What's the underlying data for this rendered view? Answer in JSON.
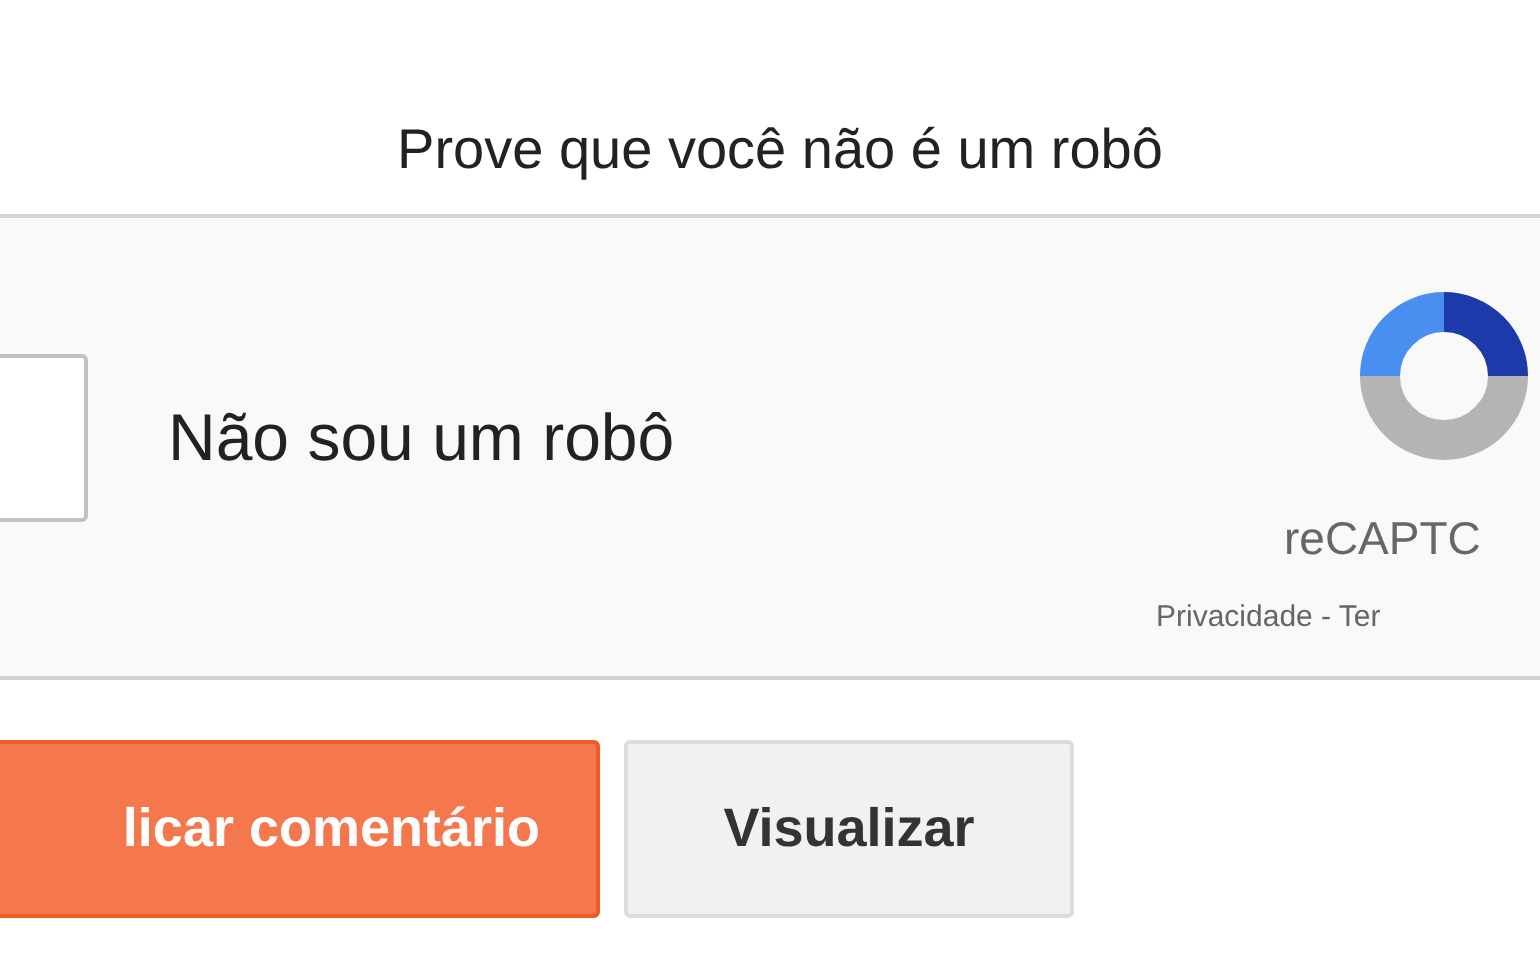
{
  "title": "Prove que você não é um robô",
  "captcha": {
    "checkbox": {
      "label": "Não sou um robô",
      "checked": false
    },
    "brand": "reCAPTC",
    "links": "Privacidade - Ter"
  },
  "buttons": [
    {
      "label": "licar comentário",
      "kind": "primary"
    },
    {
      "label": "Visualizar",
      "kind": "secondary"
    }
  ]
}
